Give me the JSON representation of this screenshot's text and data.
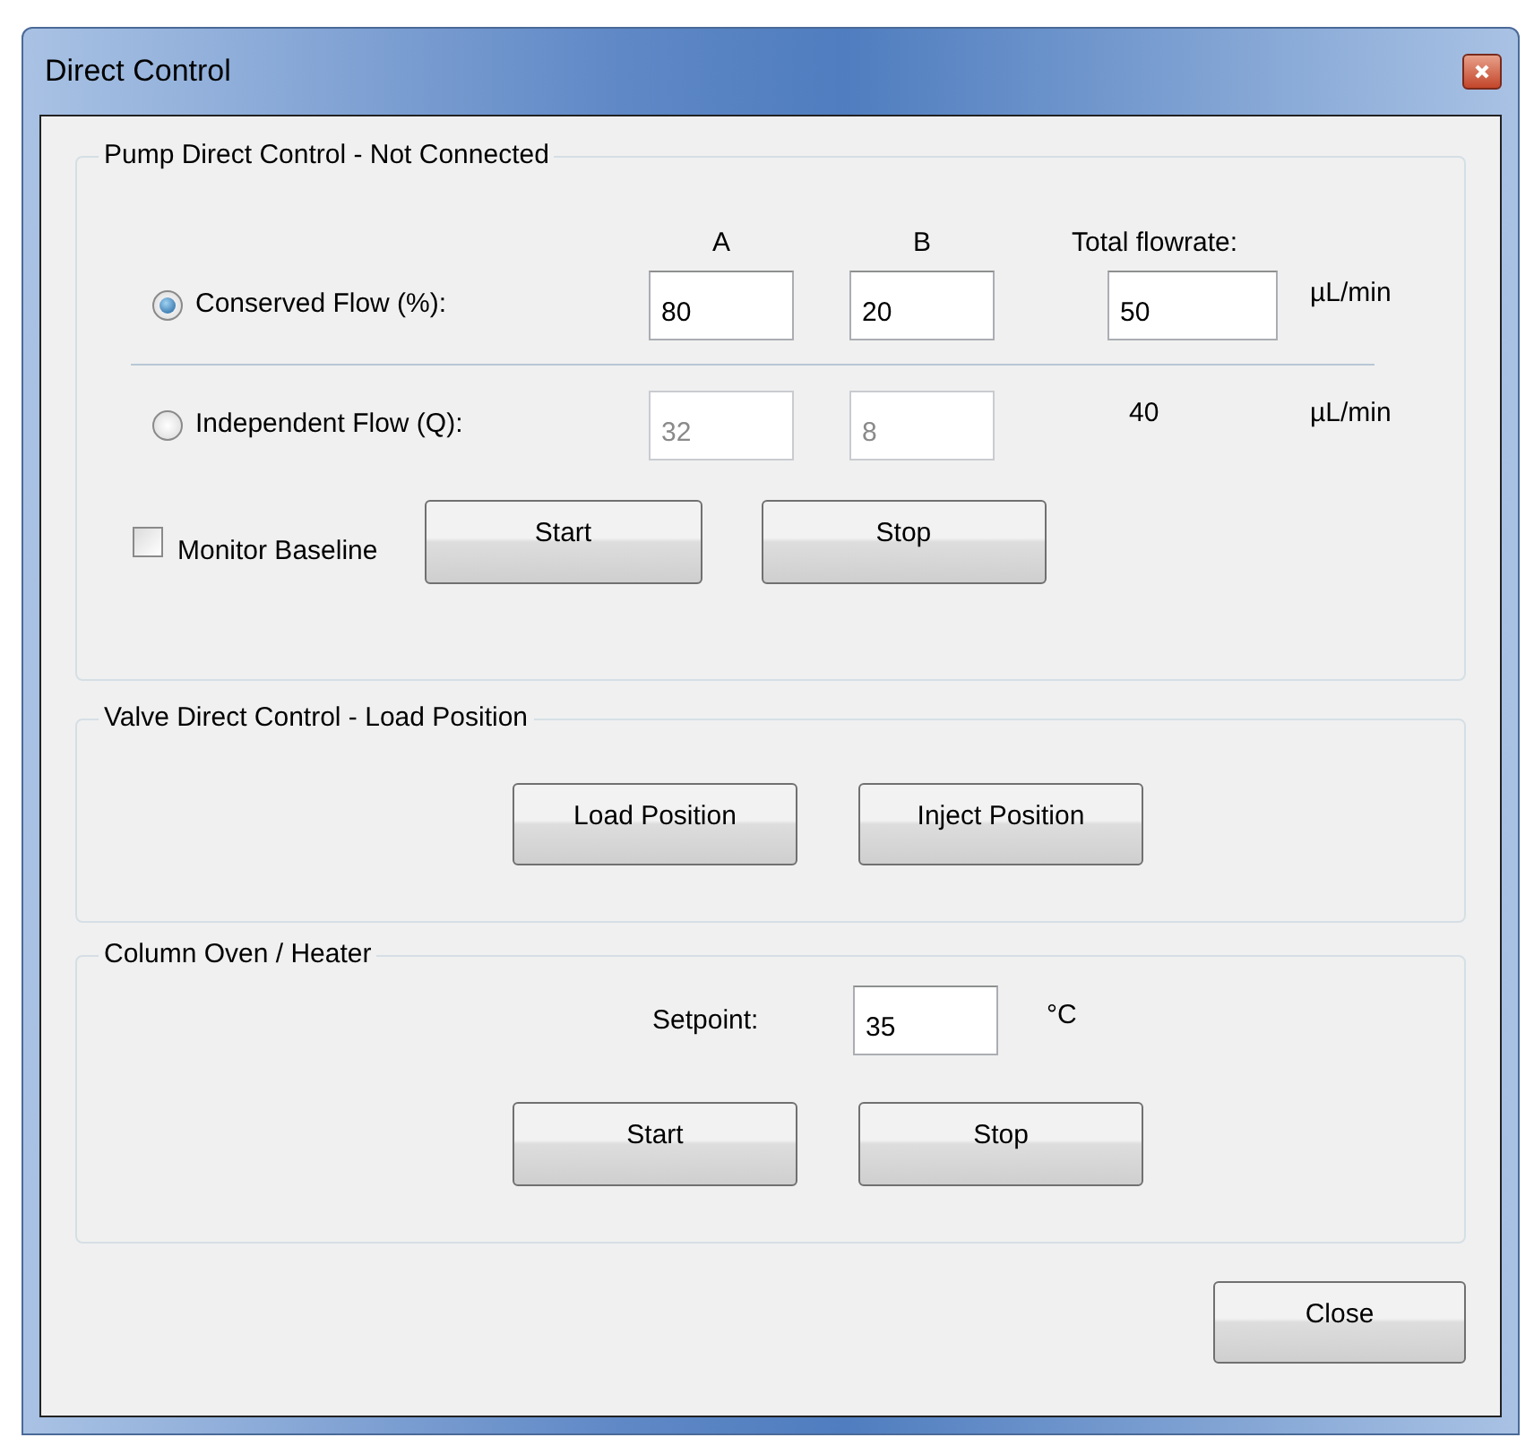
{
  "window": {
    "title": "Direct Control"
  },
  "pump": {
    "title": "Pump Direct Control - Not Connected",
    "columns": [
      "A",
      "B",
      "Total flowrate:"
    ],
    "modes": [
      {
        "label": "Conserved Flow (%):",
        "selected": true,
        "disabled": false,
        "a": "80",
        "b": "20",
        "kind": "field",
        "total": "50",
        "unit": "µL/min"
      },
      {
        "label": "Independent Flow (Q):",
        "selected": false,
        "disabled": true,
        "a": "32",
        "b": "8",
        "kind": "text",
        "total": "40",
        "unit": "µL/min"
      }
    ],
    "monitor_baseline": {
      "label": "Monitor Baseline",
      "checked": false
    },
    "buttons": [
      "Start",
      "Stop"
    ]
  },
  "valve": {
    "title": "Valve Direct Control - Load Position",
    "buttons": [
      "Load Position",
      "Inject Position"
    ]
  },
  "oven": {
    "title": "Column Oven / Heater",
    "setpoint_label": "Setpoint:",
    "setpoint": "35",
    "unit": "°C",
    "buttons": [
      "Start",
      "Stop"
    ]
  },
  "close_button": "Close"
}
